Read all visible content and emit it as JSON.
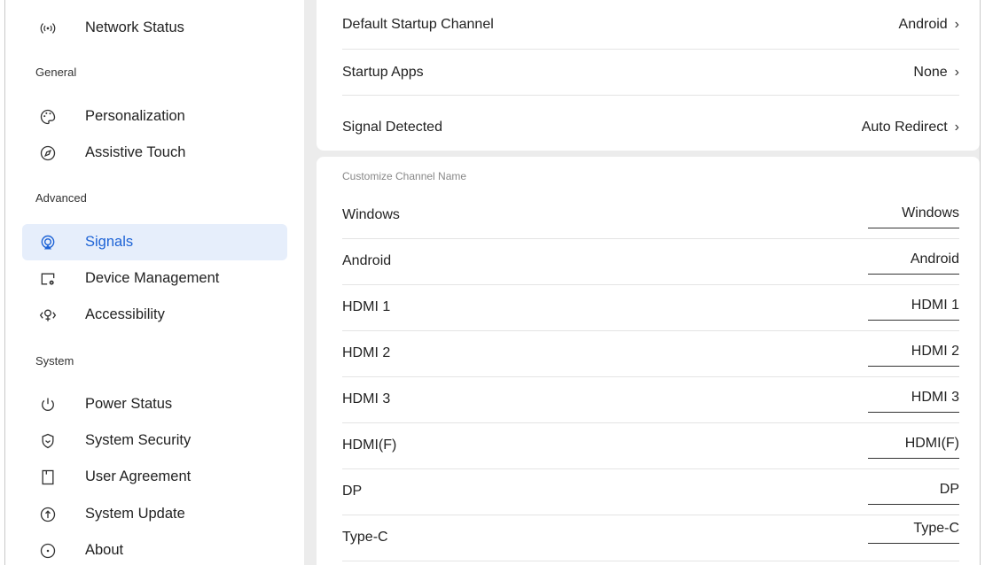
{
  "sidebar": {
    "items": [
      {
        "key": "network",
        "label": "Network Status",
        "icon": "network-icon"
      },
      {
        "key": "personalization",
        "label": "Personalization",
        "icon": "palette-icon"
      },
      {
        "key": "assistive",
        "label": "Assistive Touch",
        "icon": "compass-icon"
      },
      {
        "key": "signals",
        "label": "Signals",
        "icon": "signal-icon",
        "active": true
      },
      {
        "key": "device",
        "label": "Device Management",
        "icon": "device-gear-icon"
      },
      {
        "key": "accessibility",
        "label": "Accessibility",
        "icon": "accessibility-icon"
      },
      {
        "key": "power",
        "label": "Power Status",
        "icon": "power-icon"
      },
      {
        "key": "security",
        "label": "System Security",
        "icon": "shield-icon"
      },
      {
        "key": "agreement",
        "label": "User Agreement",
        "icon": "bookmark-icon"
      },
      {
        "key": "update",
        "label": "System Update",
        "icon": "update-arrow-icon"
      },
      {
        "key": "about",
        "label": "About",
        "icon": "info-dot-icon"
      }
    ],
    "sections": {
      "general": "General",
      "advanced": "Advanced",
      "system": "System"
    }
  },
  "settings": {
    "default_startup_channel": {
      "label": "Default Startup Channel",
      "value": "Android"
    },
    "startup_apps": {
      "label": "Startup Apps",
      "value": "None"
    },
    "signal_detected": {
      "label": "Signal Detected",
      "value": "Auto Redirect"
    }
  },
  "channels": {
    "section_title": "Customize Channel Name",
    "items": [
      {
        "name": "Windows",
        "value": "Windows"
      },
      {
        "name": "Android",
        "value": "Android"
      },
      {
        "name": "HDMI 1",
        "value": "HDMI 1"
      },
      {
        "name": "HDMI 2",
        "value": "HDMI 2"
      },
      {
        "name": "HDMI 3",
        "value": "HDMI 3"
      },
      {
        "name": "HDMI(F)",
        "value": "HDMI(F)"
      },
      {
        "name": "DP",
        "value": "DP"
      },
      {
        "name": "Type-C",
        "value": "Type-C"
      }
    ]
  },
  "colors": {
    "accent": "#1d63d6",
    "active_bg": "#e6eefb",
    "panel_bg": "#ececec"
  }
}
